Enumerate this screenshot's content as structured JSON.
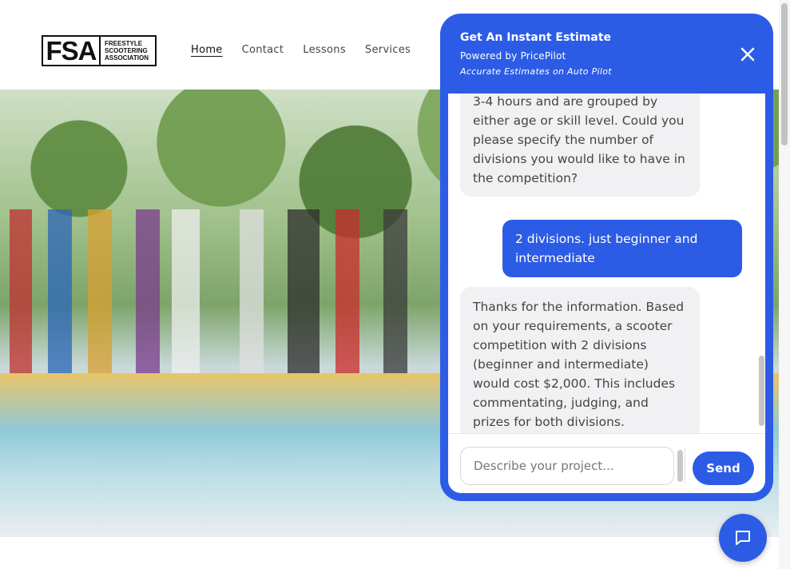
{
  "site": {
    "logo": {
      "mark": "FSA",
      "line1": "FREESTYLE",
      "line2": "SCOOTERING",
      "line3": "ASSOCIATION"
    },
    "nav": [
      {
        "label": "Home",
        "active": true
      },
      {
        "label": "Contact",
        "active": false
      },
      {
        "label": "Lessons",
        "active": false
      },
      {
        "label": "Services",
        "active": false
      }
    ]
  },
  "chat": {
    "title": "Get An Instant Estimate",
    "subtitle": "Powered by PricePilot",
    "tagline": "Accurate Estimates on Auto Pilot",
    "close_icon": "close-icon",
    "messages": [
      {
        "role": "bot",
        "text": "3-4 hours and are grouped by either age or skill level. Could you please specify the number of divisions you would like to have in the competition?"
      },
      {
        "role": "user",
        "text": "2 divisions. just beginner and intermediate"
      },
      {
        "role": "bot",
        "text": "Thanks for the information. Based on your requirements, a scooter competition with 2 divisions (beginner and intermediate) would cost $2,000. This includes commentating, judging, and prizes for both divisions."
      }
    ],
    "input_placeholder": "Describe your project...",
    "input_value": "",
    "send_label": "Send"
  },
  "launcher": {
    "icon": "chat-bubble-icon"
  },
  "colors": {
    "accent": "#2c5ce6",
    "bot_bubble": "#f1f1f3",
    "page_bg": "#ffffff"
  }
}
